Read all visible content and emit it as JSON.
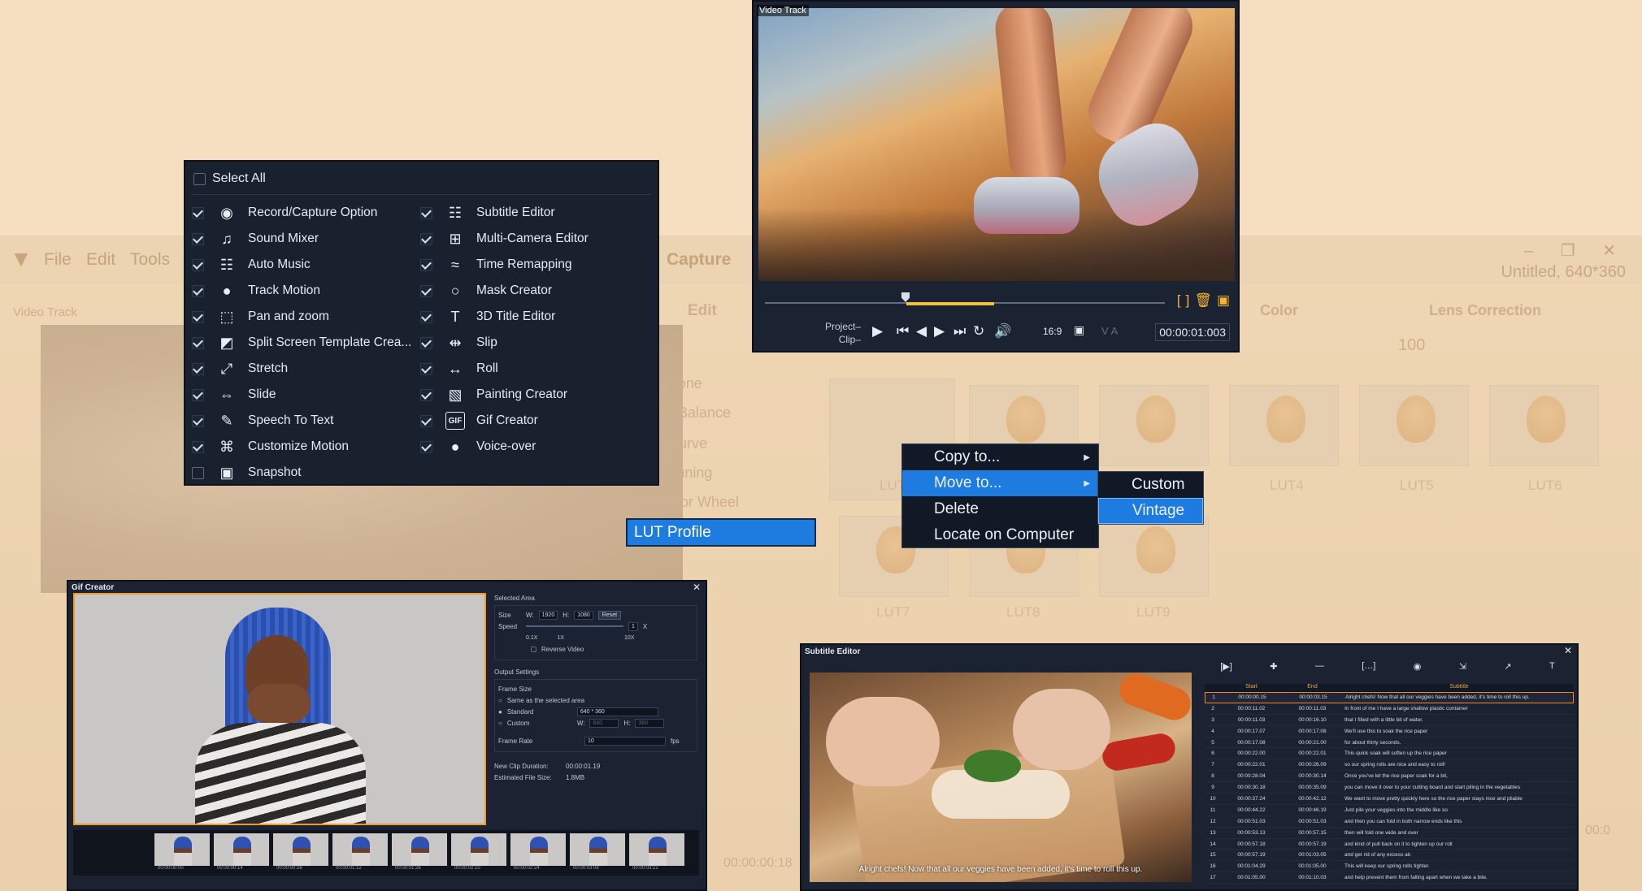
{
  "background_app": {
    "menu": [
      "File",
      "Edit",
      "Tools"
    ],
    "capture_label": "Capture",
    "edit_tab": "Edit",
    "video_track": "Video Track",
    "title": "Untitled, 640*360",
    "color_tab": "Color",
    "lens_correction": "Lens Correction",
    "zoom_value": "100",
    "color_items": [
      "o Tone",
      "ite Balance",
      "Curve",
      "Tuning",
      "Color Wheel"
    ],
    "lut_labels": [
      "LUT",
      "LUT4",
      "LUT5",
      "LUT6",
      "LUT7",
      "LUT8",
      "LUT9"
    ],
    "timecode_faded": "00:00:00:18",
    "timecode_faded_right": "00:0"
  },
  "options_panel": {
    "select_all": "Select All",
    "left": [
      {
        "label": "Record/Capture Option",
        "checked": true,
        "icon": "record-capture-icon",
        "glyph": "◉"
      },
      {
        "label": "Sound Mixer",
        "checked": true,
        "icon": "sound-mixer-icon",
        "glyph": "♫"
      },
      {
        "label": "Auto Music",
        "checked": true,
        "icon": "auto-music-icon",
        "glyph": "☷"
      },
      {
        "label": "Track Motion",
        "checked": true,
        "icon": "track-motion-icon",
        "glyph": "●"
      },
      {
        "label": "Pan and zoom",
        "checked": true,
        "icon": "pan-zoom-icon",
        "glyph": "⬚"
      },
      {
        "label": "Split Screen Template Crea...",
        "checked": true,
        "icon": "split-screen-icon",
        "glyph": "◩"
      },
      {
        "label": "Stretch",
        "checked": true,
        "icon": "stretch-icon",
        "glyph": "⤢"
      },
      {
        "label": "Slide",
        "checked": true,
        "icon": "slide-icon",
        "glyph": "⇔"
      },
      {
        "label": "Speech To Text",
        "checked": true,
        "icon": "speech-to-text-icon",
        "glyph": "✎"
      },
      {
        "label": "Customize Motion",
        "checked": true,
        "icon": "customize-motion-icon",
        "glyph": "⌘"
      },
      {
        "label": "Snapshot",
        "checked": false,
        "icon": "snapshot-icon",
        "glyph": "▣"
      }
    ],
    "right": [
      {
        "label": "Subtitle Editor",
        "checked": true,
        "icon": "subtitle-editor-icon",
        "glyph": "☷"
      },
      {
        "label": "Multi-Camera Editor",
        "checked": true,
        "icon": "multi-camera-icon",
        "glyph": "⊞"
      },
      {
        "label": "Time Remapping",
        "checked": true,
        "icon": "time-remapping-icon",
        "glyph": "≈"
      },
      {
        "label": "Mask Creator",
        "checked": true,
        "icon": "mask-creator-icon",
        "glyph": "○"
      },
      {
        "label": "3D Title Editor",
        "checked": true,
        "icon": "3d-title-icon",
        "glyph": "T"
      },
      {
        "label": "Slip",
        "checked": true,
        "icon": "slip-icon",
        "glyph": "⇹"
      },
      {
        "label": "Roll",
        "checked": true,
        "icon": "roll-icon",
        "glyph": "↔"
      },
      {
        "label": "Painting Creator",
        "checked": true,
        "icon": "painting-creator-icon",
        "glyph": "▧"
      },
      {
        "label": "Gif Creator",
        "checked": true,
        "icon": "gif-creator-icon",
        "glyph": "GIF"
      },
      {
        "label": "Voice-over",
        "checked": true,
        "icon": "voice-over-icon",
        "glyph": "●"
      }
    ]
  },
  "player": {
    "track_tag": "Video Track",
    "project": "Project",
    "clip": "Clip",
    "aspect": "16:9",
    "timecode": "00:00:01:003",
    "va": "V A"
  },
  "context_menu": {
    "items": [
      {
        "label": "Copy to...",
        "has_sub": true
      },
      {
        "label": "Move to...",
        "has_sub": true,
        "selected": true
      },
      {
        "label": "Delete",
        "has_sub": false
      },
      {
        "label": "Locate on Computer",
        "has_sub": false
      }
    ],
    "submenu": [
      {
        "label": "Custom",
        "selected": false
      },
      {
        "label": "Vintage",
        "selected": true
      }
    ]
  },
  "lut_profile": "LUT Profile",
  "gif_creator": {
    "title": "Gif Creator",
    "selected_area": "Selected Area",
    "size_label": "Size",
    "w_label": "W:",
    "w_value": "1920",
    "h_label": "H:",
    "h_value": "1080",
    "reset": "Reset",
    "speed_label": "Speed",
    "speed_value": "1",
    "speed_unit": "X",
    "speed_ticks": [
      "0.1X",
      "1X",
      "10X"
    ],
    "reverse_video": "Reverse Video",
    "output_settings": "Output Settings",
    "frame_size": "Frame Size",
    "same_as_selected": "Same as the selected area",
    "standard": "Standard",
    "standard_value": "640 * 360",
    "custom": "Custom",
    "custom_w": "640",
    "custom_h": "360",
    "frame_rate_label": "Frame Rate",
    "frame_rate_value": "10",
    "fps": "fps",
    "new_clip_duration_label": "New Clip Duration:",
    "new_clip_duration": "00:00:01.19",
    "est_file_size_label": "Estimated File Size:",
    "est_file_size": "1.8MB",
    "frame_timecodes": [
      "00:00:00:00",
      "00:00:00:14",
      "00:00:00:28",
      "00:00:01:12",
      "00:00:01:26",
      "00:00:02:10",
      "00:00:02:24",
      "00:00:03:08",
      "00:00:03:22"
    ]
  },
  "subtitle_editor": {
    "title": "Subtitle Editor",
    "caption": "Alright chefs! Now that all our veggies have been added, it's time to roll this up.",
    "headers": [
      "",
      "Start",
      "End",
      "Subtitle"
    ],
    "rows": [
      [
        "1",
        "00:00:00.15",
        "00:00:03.15",
        "Alright chefs! Now that all our veggies have been added, it's time to roll this up."
      ],
      [
        "2",
        "00:00:11.02",
        "00:00:11.03",
        "In front of me I have a large shallow plastic container"
      ],
      [
        "3",
        "00:00:11.03",
        "00:00:16.10",
        "that I filled with a little bit of water."
      ],
      [
        "4",
        "00:00:17.07",
        "00:00:17.08",
        "We'll use this to soak the rice paper"
      ],
      [
        "5",
        "00:00:17.08",
        "00:00:21.00",
        "for about thirty seconds."
      ],
      [
        "6",
        "00:00:22.00",
        "00:00:22.01",
        "This quick soak will soften up the rice paper"
      ],
      [
        "7",
        "00:00:22.01",
        "00:00:26.09",
        "so our spring rolls are nice and easy to roll!"
      ],
      [
        "8",
        "00:00:28.04",
        "00:00:30.14",
        "Once you've let the rice paper soak for a bit,"
      ],
      [
        "9",
        "00:00:30.18",
        "00:00:35.09",
        "you can move it over to your cutting board and start piling in the vegetables"
      ],
      [
        "10",
        "00:00:37.24",
        "00:00:42.12",
        "We want to move pretty quickly here so the rice paper stays nice and pliable"
      ],
      [
        "11",
        "00:00:44.22",
        "00:00:46.19",
        "Just pile your veggies into the middle like so"
      ],
      [
        "12",
        "00:00:51.03",
        "00:00:51.03",
        "and then you can fold in both narrow ends like this"
      ],
      [
        "13",
        "00:00:53.13",
        "00:00:57.15",
        "then will fold one wide and over"
      ],
      [
        "14",
        "00:00:57.18",
        "00:00:57.19",
        "and kind of pull back on it to tighten up our roll"
      ],
      [
        "15",
        "00:00:57.19",
        "00:01:03.05",
        "and get rid of any excess air."
      ],
      [
        "16",
        "00:01:04.29",
        "00:01:05.00",
        "This will keep our spring rolls tighter."
      ],
      [
        "17",
        "00:01:05.00",
        "00:01:10.03",
        "and help prevent them from falling apart when we take a bite."
      ]
    ]
  }
}
